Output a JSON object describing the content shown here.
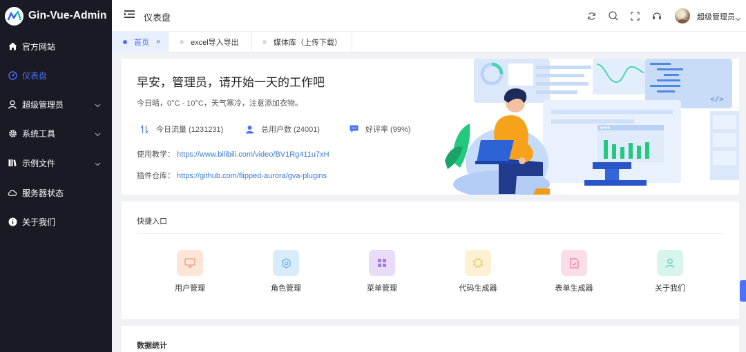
{
  "app": {
    "name": "Gin-Vue-Admin"
  },
  "sidebar": {
    "items": [
      {
        "label": "官方网站",
        "icon": "home-icon"
      },
      {
        "label": "仪表盘",
        "icon": "dashboard-icon",
        "active": true
      },
      {
        "label": "超级管理员",
        "icon": "user-icon",
        "expandable": true
      },
      {
        "label": "系统工具",
        "icon": "gear-icon",
        "expandable": true
      },
      {
        "label": "示例文件",
        "icon": "folder-icon",
        "expandable": true
      },
      {
        "label": "服务器状态",
        "icon": "cloud-icon"
      },
      {
        "label": "关于我们",
        "icon": "info-icon"
      }
    ]
  },
  "header": {
    "title": "仪表盘",
    "user_name": "超级管理员",
    "icons": [
      "refresh-icon",
      "search-icon",
      "fullscreen-icon",
      "headset-icon"
    ]
  },
  "tabs": [
    {
      "label": "首页",
      "active": true,
      "closable": true,
      "close": "×"
    },
    {
      "label": "excel导入导出"
    },
    {
      "label": "媒体库（上传下载）"
    }
  ],
  "welcome": {
    "greeting": "早安，管理员，请开始一天的工作吧",
    "weather": "今日晴，0°C - 10°C，天气寒冷，注意添加衣物。",
    "stats": [
      {
        "label": "今日流量 (1231231)",
        "icon": "traffic-icon"
      },
      {
        "label": "总用户数 (24001)",
        "icon": "users-icon"
      },
      {
        "label": "好评率 (99%)",
        "icon": "comment-icon"
      }
    ],
    "tutorial": {
      "label": "使用教学：",
      "url": "https://www.bilibili.com/video/BV1Rg411u7xH"
    },
    "plugins": {
      "label": "插件仓库：",
      "url": "https://github.com/flipped-aurora/gva-plugins"
    }
  },
  "quick": {
    "title": "快捷入口",
    "items": [
      {
        "label": "用户管理",
        "icon": "monitor-icon",
        "bg": "#fde6d8",
        "fg": "#ee9d73"
      },
      {
        "label": "角色管理",
        "icon": "setting-icon",
        "bg": "#d9ecfb",
        "fg": "#5fa8e8"
      },
      {
        "label": "菜单管理",
        "icon": "menu-grid-icon",
        "bg": "#e9dcf8",
        "fg": "#a57ae2"
      },
      {
        "label": "代码生成器",
        "icon": "chip-icon",
        "bg": "#fdf1d4",
        "fg": "#efc05a"
      },
      {
        "label": "表单生成器",
        "icon": "document-check-icon",
        "bg": "#fbdde8",
        "fg": "#e978a4"
      },
      {
        "label": "关于我们",
        "icon": "user-outline-icon",
        "bg": "#d8f4ee",
        "fg": "#59c7ae"
      }
    ]
  },
  "statistics": {
    "title": "数据统计"
  },
  "colors": {
    "accent": "#4d70ff",
    "sidebar_bg": "#191a23",
    "link": "#3a7bd5"
  }
}
